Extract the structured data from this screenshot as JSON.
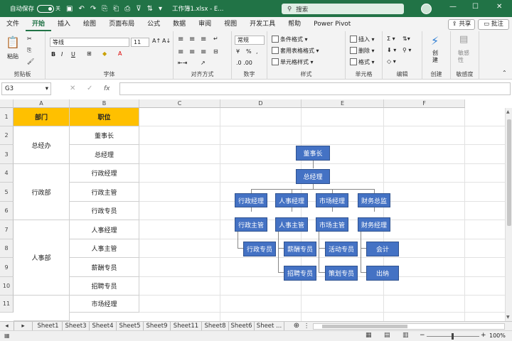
{
  "titlebar": {
    "autosave": "自动保存",
    "toggle": "关",
    "filename": "工作簿1.xlsx  -  E...",
    "search_placeholder": "搜索"
  },
  "tabs": [
    "文件",
    "开始",
    "插入",
    "绘图",
    "页面布局",
    "公式",
    "数据",
    "审阅",
    "视图",
    "开发工具",
    "帮助",
    "Power Pivot"
  ],
  "share_label": "共享",
  "comment_label": "批注",
  "ribbon": {
    "paste": "粘贴",
    "font_name": "等线",
    "font_size": "11",
    "bold": "B",
    "italic": "I",
    "underline": "U",
    "number_format": "常规",
    "cond_format": "条件格式",
    "table_format": "套用表格格式",
    "cell_style": "单元格样式",
    "insert": "插入",
    "delete": "删除",
    "format": "格式",
    "create": "创\n建",
    "sensitivity": "敏感\n性",
    "groups": [
      "剪贴板",
      "字体",
      "对齐方式",
      "数字",
      "样式",
      "单元格",
      "编辑",
      "创建",
      "敏感度"
    ]
  },
  "formula_bar": {
    "name_box": "G3",
    "fx": "fx",
    "value": ""
  },
  "columns": [
    "A",
    "B",
    "C",
    "D",
    "E",
    "F"
  ],
  "rows": [
    "1",
    "2",
    "3",
    "4",
    "5",
    "6",
    "7",
    "8",
    "9",
    "10",
    "11"
  ],
  "table": {
    "header": [
      "部门",
      "职位"
    ],
    "dept": [
      "总经办",
      "行政部",
      "人事部"
    ],
    "positions": [
      "董事长",
      "总经理",
      "行政经理",
      "行政主管",
      "行政专员",
      "人事经理",
      "人事主管",
      "薪酬专员",
      "招聘专员",
      "市场经理"
    ]
  },
  "org": {
    "top": "董事长",
    "second": "总经理",
    "managers": [
      "行政经理",
      "人事经理",
      "市场经理",
      "财务总监"
    ],
    "leads": [
      "行政主管",
      "人事主管",
      "市场主管",
      "财务经理"
    ],
    "row3": [
      "行政专员",
      "薪酬专员",
      "活动专员",
      "会计"
    ],
    "row4": [
      "招聘专员",
      "策划专员",
      "出纳"
    ]
  },
  "sheets": [
    "Sheet1",
    "Sheet3",
    "Sheet4",
    "Sheet5",
    "Sheet9",
    "Sheet11",
    "Sheet8",
    "Sheet6",
    "Sheet ..."
  ],
  "zoom": "100%"
}
